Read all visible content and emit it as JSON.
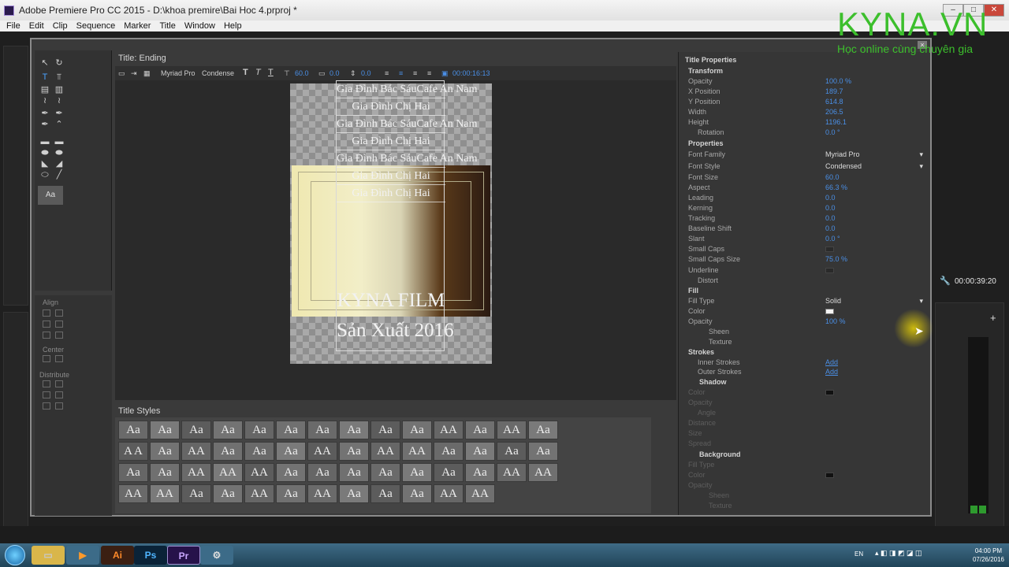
{
  "window": {
    "title": "Adobe Premiere Pro CC 2015 - D:\\khoa premire\\Bai Hoc 4.prproj *",
    "min": "–",
    "max": "□",
    "close": "✕"
  },
  "menu": [
    "File",
    "Edit",
    "Clip",
    "Sequence",
    "Marker",
    "Title",
    "Window",
    "Help"
  ],
  "titler": {
    "tab": "Title: Ending",
    "font": "Myriad Pro",
    "style": "Condense",
    "size": "60.0",
    "kern": "0.0",
    "lead": "0.0",
    "timecode": "00:00:16:13",
    "align_label": "Align",
    "center_label": "Center",
    "distribute_label": "Distribute",
    "roll_lines": [
      "Gia Đình Bác SáuCafe An Nam",
      "Gia Đình Chị Hai",
      "Gia Đình Bác SáuCafe An Nam",
      "Gia Đình Chị Hai",
      "Gia Đình Bác SáuCafe An Nam",
      "Gia Đình Chị Hai",
      "Gia Đình Chị Hai"
    ],
    "roll_big1": "KYNA FILM",
    "roll_big2": "Sản Xuất 2016",
    "styles_tab": "Title Styles",
    "swatch_text": [
      "Aa",
      "Aa",
      "Aa",
      "Aa",
      "Aa",
      "Aa",
      "Aa",
      "Aa",
      "Aa",
      "Aa",
      "AA",
      "Aa",
      "AA",
      "Aa",
      "A A",
      "Aa",
      "AA",
      "Aa",
      "Aa",
      "Aa",
      "AA",
      "Aa",
      "AA",
      "AA",
      "Aa",
      "Aa",
      "Aa",
      "Aa",
      "Aa",
      "Aa",
      "AA",
      "AA",
      "AA",
      "Aa",
      "Aa",
      "Aa",
      "Aa",
      "Aa",
      "Aa",
      "Aa",
      "AA",
      "AA",
      "AA",
      "AA",
      "Aa",
      "Aa",
      "AA",
      "Aa",
      "AA",
      "Aa",
      "Aa",
      "Aa",
      "AA",
      "AA"
    ]
  },
  "props": {
    "title": "Title Properties",
    "transform": "Transform",
    "opacity": {
      "label": "Opacity",
      "value": "100.0 %"
    },
    "xpos": {
      "label": "X Position",
      "value": "189.7"
    },
    "ypos": {
      "label": "Y Position",
      "value": "614.8"
    },
    "width": {
      "label": "Width",
      "value": "206.5"
    },
    "height": {
      "label": "Height",
      "value": "1196.1"
    },
    "rotation": {
      "label": "Rotation",
      "value": "0.0 °"
    },
    "properties": "Properties",
    "font_family": {
      "label": "Font Family",
      "value": "Myriad Pro"
    },
    "font_style": {
      "label": "Font Style",
      "value": "Condensed"
    },
    "font_size": {
      "label": "Font Size",
      "value": "60.0"
    },
    "aspect": {
      "label": "Aspect",
      "value": "66.3 %"
    },
    "leading": {
      "label": "Leading",
      "value": "0.0"
    },
    "kerning": {
      "label": "Kerning",
      "value": "0.0"
    },
    "tracking": {
      "label": "Tracking",
      "value": "0.0"
    },
    "baseline": {
      "label": "Baseline Shift",
      "value": "0.0"
    },
    "slant": {
      "label": "Slant",
      "value": "0.0 °"
    },
    "small_caps": {
      "label": "Small Caps"
    },
    "small_caps_size": {
      "label": "Small Caps Size",
      "value": "75.0 %"
    },
    "underline": {
      "label": "Underline"
    },
    "distort": {
      "label": "Distort"
    },
    "fill": "Fill",
    "fill_type": {
      "label": "Fill Type",
      "value": "Solid"
    },
    "color": {
      "label": "Color"
    },
    "fill_opacity": {
      "label": "Opacity",
      "value": "100 %"
    },
    "sheen": {
      "label": "Sheen"
    },
    "texture": {
      "label": "Texture"
    },
    "strokes": "Strokes",
    "inner": {
      "label": "Inner Strokes",
      "value": "Add"
    },
    "outer": {
      "label": "Outer Strokes",
      "value": "Add"
    },
    "shadow": "Shadow",
    "sh_color": "Color",
    "sh_opacity": "Opacity",
    "sh_angle": "Angle",
    "sh_distance": "Distance",
    "sh_size": "Size",
    "sh_spread": "Spread",
    "background": "Background",
    "bg_fill": "Fill Type",
    "bg_color": "Color",
    "bg_opacity": "Opacity",
    "bg_sheen": "Sheen",
    "bg_texture": "Texture"
  },
  "logo": {
    "brand": "KYNA.VN",
    "tag": "Học online cùng chuyên gia"
  },
  "program": {
    "timecode": "00:00:39:20"
  },
  "taskbar": {
    "lang": "EN",
    "time": "04:00 PM",
    "date": "07/26/2016",
    "apps": [
      "Ai",
      "Ps",
      "Pr"
    ]
  },
  "colors": {
    "accent": "#4a8fe6",
    "brand": "#3cbf2c"
  }
}
